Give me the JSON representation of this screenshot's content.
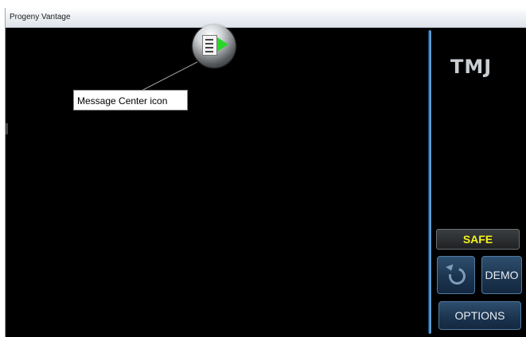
{
  "window": {
    "title": "Progeny Vantage"
  },
  "main": {
    "message_center_button": {
      "icon": "message-center-icon"
    },
    "callout": {
      "text": "Message Center icon"
    }
  },
  "sidebar": {
    "station_label": "TMJ",
    "safe_label": "SAFE",
    "undo_icon": "undo-icon",
    "demo_label": "DEMO",
    "options_label": "OPTIONS"
  },
  "colors": {
    "background": "#000000",
    "safe_text": "#f2f21a",
    "button_blue": "#1c3550",
    "divider_blue": "#3d86c8",
    "play_green": "#2ad62a"
  }
}
